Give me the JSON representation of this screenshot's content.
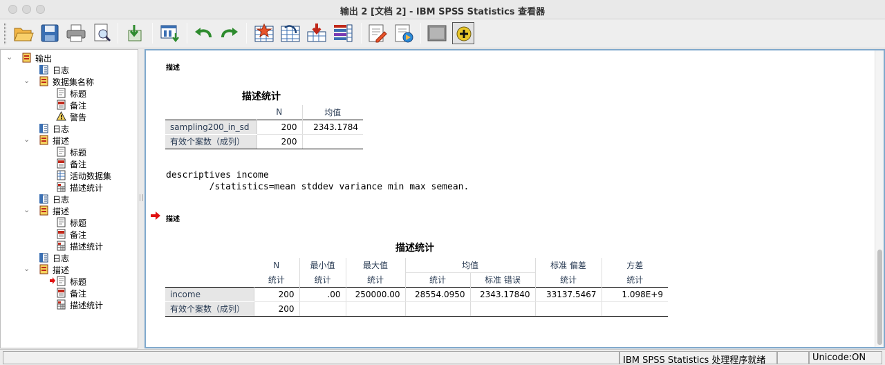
{
  "window": {
    "title": "输出 2 [文档 2] - IBM SPSS Statistics 查看器"
  },
  "toolbar": {
    "buttons": [
      {
        "name": "open-icon"
      },
      {
        "name": "save-icon"
      },
      {
        "name": "print-icon"
      },
      {
        "name": "print-preview-icon"
      },
      {
        "name": "export-icon"
      },
      {
        "name": "recall-dialog-icon"
      },
      {
        "name": "undo-icon"
      },
      {
        "name": "redo-icon"
      },
      {
        "name": "goto-data-icon"
      },
      {
        "name": "goto-case-icon"
      },
      {
        "name": "goto-variable-icon"
      },
      {
        "name": "variables-icon"
      },
      {
        "name": "insert-text-icon"
      },
      {
        "name": "insert-title-icon"
      },
      {
        "name": "show-hide-icon"
      },
      {
        "name": "designate-window-icon"
      }
    ]
  },
  "outline": {
    "items": [
      {
        "label": "输出",
        "level": 0,
        "expanded": true,
        "icon": "output-book-icon"
      },
      {
        "label": "日志",
        "level": 1,
        "icon": "log-icon"
      },
      {
        "label": "数据集名称",
        "level": 1,
        "expanded": true,
        "icon": "procedure-book-icon"
      },
      {
        "label": "标题",
        "level": 2,
        "icon": "title-icon"
      },
      {
        "label": "备注",
        "level": 2,
        "icon": "notes-icon"
      },
      {
        "label": "警告",
        "level": 2,
        "icon": "warning-icon"
      },
      {
        "label": "日志",
        "level": 1,
        "icon": "log-icon"
      },
      {
        "label": "描述",
        "level": 1,
        "expanded": true,
        "icon": "procedure-book-icon"
      },
      {
        "label": "标题",
        "level": 2,
        "icon": "title-icon"
      },
      {
        "label": "备注",
        "level": 2,
        "icon": "notes-icon"
      },
      {
        "label": "活动数据集",
        "level": 2,
        "icon": "dataset-icon"
      },
      {
        "label": "描述统计",
        "level": 2,
        "icon": "table-icon"
      },
      {
        "label": "日志",
        "level": 1,
        "icon": "log-icon"
      },
      {
        "label": "描述",
        "level": 1,
        "expanded": true,
        "icon": "procedure-book-icon"
      },
      {
        "label": "标题",
        "level": 2,
        "icon": "title-icon"
      },
      {
        "label": "备注",
        "level": 2,
        "icon": "notes-icon"
      },
      {
        "label": "描述统计",
        "level": 2,
        "icon": "table-icon"
      },
      {
        "label": "日志",
        "level": 1,
        "icon": "log-icon"
      },
      {
        "label": "描述",
        "level": 1,
        "expanded": true,
        "icon": "procedure-book-icon"
      },
      {
        "label": "标题",
        "level": 2,
        "icon": "title-icon",
        "current": true
      },
      {
        "label": "备注",
        "level": 2,
        "icon": "notes-icon"
      },
      {
        "label": "描述统计",
        "level": 2,
        "icon": "table-icon"
      }
    ]
  },
  "content": {
    "section1_title": "描述",
    "table1": {
      "title": "描述统计",
      "headers": [
        "N",
        "均值"
      ],
      "rows": [
        {
          "label": "sampling200_in_sd",
          "values": [
            "200",
            "2343.1784"
          ]
        },
        {
          "label": "有效个案数（成列）",
          "values": [
            "200",
            ""
          ]
        }
      ]
    },
    "syntax_line1": "descriptives income",
    "syntax_line2": "        /statistics=mean stddev variance min max semean.",
    "section2_title": "描述",
    "table2": {
      "title": "描述统计",
      "header_groups": [
        "N",
        "最小值",
        "最大值",
        "均值",
        "标准 偏差",
        "方差"
      ],
      "subheaders": [
        "统计",
        "统计",
        "统计",
        "统计",
        "标准 错误",
        "统计",
        "统计"
      ],
      "rows": [
        {
          "label": "income",
          "values": [
            "200",
            ".00",
            "250000.00",
            "28554.0950",
            "2343.17840",
            "33137.5467",
            "1.098E+9"
          ]
        },
        {
          "label": "有效个案数（成列）",
          "values": [
            "200",
            "",
            "",
            "",
            "",
            "",
            ""
          ]
        }
      ]
    }
  },
  "statusbar": {
    "processor": "IBM SPSS Statistics 处理程序就绪",
    "unicode": "Unicode:ON"
  }
}
